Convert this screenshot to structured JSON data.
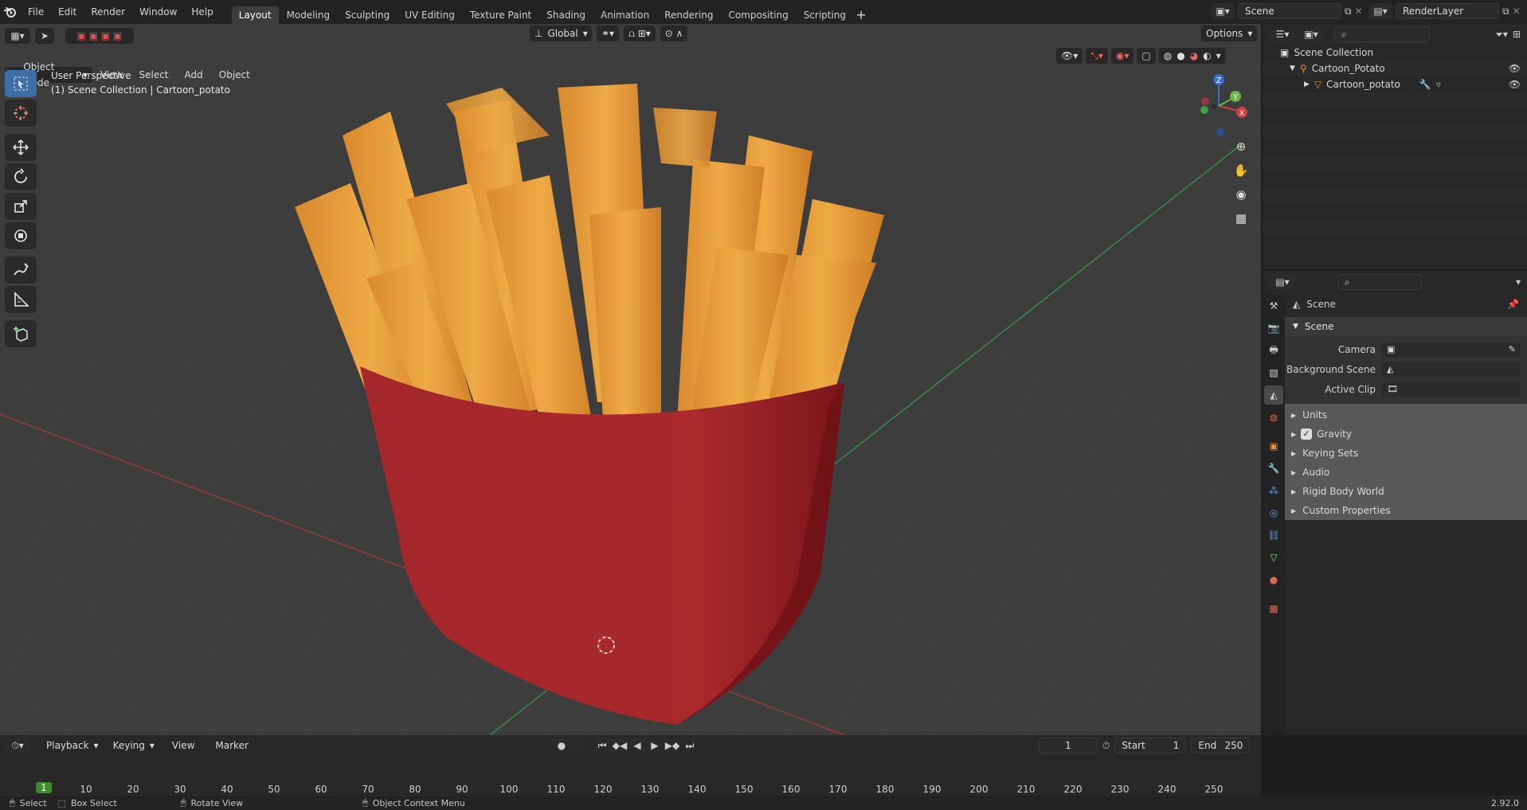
{
  "topbar": {
    "menus": [
      "File",
      "Edit",
      "Render",
      "Window",
      "Help"
    ],
    "tabs": [
      "Layout",
      "Modeling",
      "Sculpting",
      "UV Editing",
      "Texture Paint",
      "Shading",
      "Animation",
      "Rendering",
      "Compositing",
      "Scripting"
    ],
    "active_tab": "Layout",
    "scene_name": "Scene",
    "view_layer": "RenderLayer"
  },
  "viewport": {
    "mode": "Object Mode",
    "menus": [
      "View",
      "Select",
      "Add",
      "Object"
    ],
    "orientation": "Global",
    "options_label": "Options",
    "perspective": "User Perspective",
    "context": "(1) Scene Collection | Cartoon_potato",
    "gizmo": {
      "x": "X",
      "y": "Y",
      "z": "Z"
    }
  },
  "outliner": {
    "root": "Scene Collection",
    "collection": "Cartoon_Potato",
    "object": "Cartoon_potato"
  },
  "properties": {
    "header": "Scene",
    "panel": "Scene",
    "camera_label": "Camera",
    "background_label": "Background Scene",
    "clip_label": "Active Clip",
    "subpanels": {
      "units": "Units",
      "gravity": "Gravity",
      "keying_sets": "Keying Sets",
      "audio": "Audio",
      "rigid_body": "Rigid Body World",
      "custom_props": "Custom Properties"
    },
    "gravity_enabled": true
  },
  "timeline": {
    "menus": [
      "Playback",
      "Keying",
      "View",
      "Marker"
    ],
    "current_frame": "1",
    "start_label": "Start",
    "start_value": "1",
    "end_label": "End",
    "end_value": "250",
    "frames": [
      "1",
      "10",
      "20",
      "30",
      "40",
      "50",
      "60",
      "70",
      "80",
      "90",
      "100",
      "110",
      "120",
      "130",
      "140",
      "150",
      "160",
      "170",
      "180",
      "190",
      "200",
      "210",
      "220",
      "230",
      "240",
      "250"
    ]
  },
  "statusbar": {
    "select": "Select",
    "box_select": "Box Select",
    "rotate_view": "Rotate View",
    "context_menu": "Object Context Menu",
    "version": "2.92.0"
  },
  "colors": {
    "accent": "#3d6ea8",
    "fries": "#e7a13c",
    "container": "#a3262a",
    "frame_marker": "#3e8e2a"
  }
}
